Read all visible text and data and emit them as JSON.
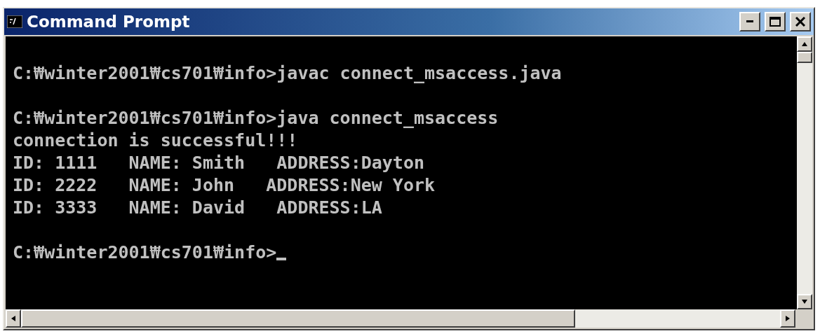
{
  "window": {
    "title": "Command Prompt"
  },
  "console": {
    "blocks": [
      [
        "C:₩winter2001₩cs701₩info>javac connect_msaccess.java"
      ],
      [
        "C:₩winter2001₩cs701₩info>java connect_msaccess",
        "connection is successful!!!",
        "ID: 1111   NAME: Smith   ADDRESS:Dayton",
        "ID: 2222   NAME: John   ADDRESS:New York",
        "ID: 3333   NAME: David   ADDRESS:LA"
      ],
      [
        "C:₩winter2001₩cs701₩info>"
      ]
    ]
  }
}
